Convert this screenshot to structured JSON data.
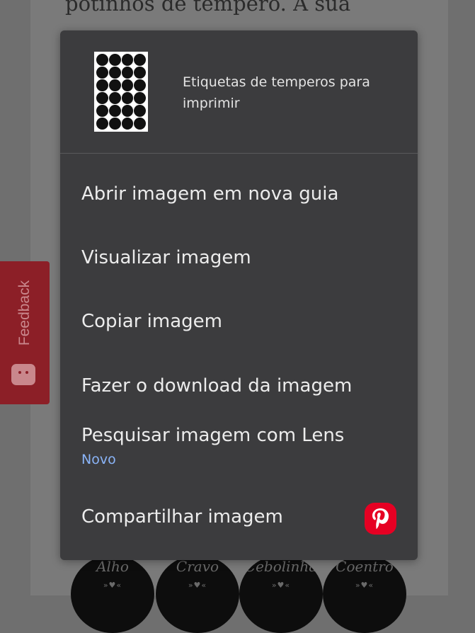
{
  "background": {
    "text_fragment": "potinhos de tempero. A sua",
    "labels": [
      "Alho",
      "Cravo",
      "Cebolinha",
      "Coentro"
    ]
  },
  "feedback": {
    "label": "Feedback"
  },
  "context_menu": {
    "title": "Etiquetas de temperos para imprimir",
    "items": [
      {
        "label": "Abrir imagem em nova guia"
      },
      {
        "label": "Visualizar imagem"
      },
      {
        "label": "Copiar imagem"
      },
      {
        "label": "Fazer o download da imagem"
      },
      {
        "label": "Pesquisar imagem com Lens",
        "badge": "Novo"
      },
      {
        "label": "Compartilhar imagem",
        "icon": "pinterest-icon"
      }
    ]
  },
  "colors": {
    "menu_bg": "#3c3c3e",
    "badge_blue": "#8ab4f8",
    "pinterest_red": "#e60023",
    "feedback_red": "#8c1f27"
  }
}
